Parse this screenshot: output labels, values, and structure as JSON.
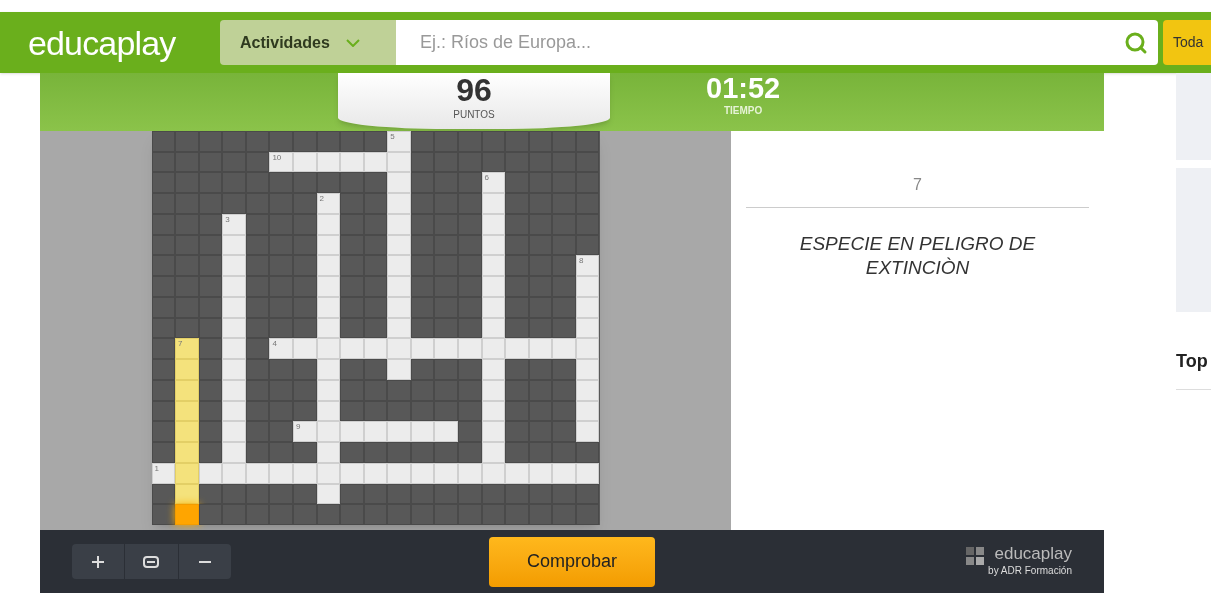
{
  "header": {
    "logo": "educaplay",
    "category": "Actividades",
    "search": {
      "placeholder": "Ej.: Ríos de Europa..."
    },
    "button": "Toda"
  },
  "score": {
    "points": "96",
    "points_label": "PUNTOS",
    "time": "01:52",
    "time_label": "TIEMPO"
  },
  "crossword": {
    "rows": [
      [
        {
          "kind": "block"
        },
        {
          "kind": "block"
        },
        {
          "kind": "block"
        },
        {
          "kind": "block"
        },
        {
          "kind": "block"
        },
        {
          "kind": "block"
        },
        {
          "kind": "block"
        },
        {
          "kind": "block"
        },
        {
          "kind": "block"
        },
        {
          "kind": "block"
        },
        {
          "kind": "blank",
          "number": "5"
        },
        {
          "kind": "block"
        },
        {
          "kind": "block"
        },
        {
          "kind": "block"
        },
        {
          "kind": "block"
        },
        {
          "kind": "block"
        },
        {
          "kind": "block"
        },
        {
          "kind": "block"
        },
        {
          "kind": "block"
        }
      ],
      [
        {
          "kind": "block"
        },
        {
          "kind": "block"
        },
        {
          "kind": "block"
        },
        {
          "kind": "block"
        },
        {
          "kind": "block"
        },
        {
          "kind": "blank",
          "number": "10"
        },
        {
          "kind": "blank"
        },
        {
          "kind": "blank"
        },
        {
          "kind": "blank"
        },
        {
          "kind": "blank"
        },
        {
          "kind": "blank"
        },
        {
          "kind": "block"
        },
        {
          "kind": "block"
        },
        {
          "kind": "block"
        },
        {
          "kind": "block"
        },
        {
          "kind": "block"
        },
        {
          "kind": "block"
        },
        {
          "kind": "block"
        },
        {
          "kind": "block"
        }
      ],
      [
        {
          "kind": "block"
        },
        {
          "kind": "block"
        },
        {
          "kind": "block"
        },
        {
          "kind": "block"
        },
        {
          "kind": "block"
        },
        {
          "kind": "block"
        },
        {
          "kind": "block"
        },
        {
          "kind": "block"
        },
        {
          "kind": "block"
        },
        {
          "kind": "block"
        },
        {
          "kind": "blank"
        },
        {
          "kind": "block"
        },
        {
          "kind": "block"
        },
        {
          "kind": "block"
        },
        {
          "kind": "blank",
          "number": "6"
        },
        {
          "kind": "block"
        },
        {
          "kind": "block"
        },
        {
          "kind": "block"
        },
        {
          "kind": "block"
        }
      ],
      [
        {
          "kind": "block"
        },
        {
          "kind": "block"
        },
        {
          "kind": "block"
        },
        {
          "kind": "block"
        },
        {
          "kind": "block"
        },
        {
          "kind": "block"
        },
        {
          "kind": "block"
        },
        {
          "kind": "blank",
          "number": "2"
        },
        {
          "kind": "block"
        },
        {
          "kind": "block"
        },
        {
          "kind": "blank"
        },
        {
          "kind": "block"
        },
        {
          "kind": "block"
        },
        {
          "kind": "block"
        },
        {
          "kind": "blank"
        },
        {
          "kind": "block"
        },
        {
          "kind": "block"
        },
        {
          "kind": "block"
        },
        {
          "kind": "block"
        }
      ],
      [
        {
          "kind": "block"
        },
        {
          "kind": "block"
        },
        {
          "kind": "block"
        },
        {
          "kind": "blank",
          "number": "3"
        },
        {
          "kind": "block"
        },
        {
          "kind": "block"
        },
        {
          "kind": "block"
        },
        {
          "kind": "blank"
        },
        {
          "kind": "block"
        },
        {
          "kind": "block"
        },
        {
          "kind": "blank"
        },
        {
          "kind": "block"
        },
        {
          "kind": "block"
        },
        {
          "kind": "block"
        },
        {
          "kind": "blank"
        },
        {
          "kind": "block"
        },
        {
          "kind": "block"
        },
        {
          "kind": "block"
        },
        {
          "kind": "block"
        }
      ],
      [
        {
          "kind": "block"
        },
        {
          "kind": "block"
        },
        {
          "kind": "block"
        },
        {
          "kind": "blank"
        },
        {
          "kind": "block"
        },
        {
          "kind": "block"
        },
        {
          "kind": "block"
        },
        {
          "kind": "blank"
        },
        {
          "kind": "block"
        },
        {
          "kind": "block"
        },
        {
          "kind": "blank"
        },
        {
          "kind": "block"
        },
        {
          "kind": "block"
        },
        {
          "kind": "block"
        },
        {
          "kind": "blank"
        },
        {
          "kind": "block"
        },
        {
          "kind": "block"
        },
        {
          "kind": "block"
        },
        {
          "kind": "block"
        }
      ],
      [
        {
          "kind": "block"
        },
        {
          "kind": "block"
        },
        {
          "kind": "block"
        },
        {
          "kind": "blank"
        },
        {
          "kind": "block"
        },
        {
          "kind": "block"
        },
        {
          "kind": "block"
        },
        {
          "kind": "blank"
        },
        {
          "kind": "block"
        },
        {
          "kind": "block"
        },
        {
          "kind": "blank"
        },
        {
          "kind": "block"
        },
        {
          "kind": "block"
        },
        {
          "kind": "block"
        },
        {
          "kind": "blank"
        },
        {
          "kind": "block"
        },
        {
          "kind": "block"
        },
        {
          "kind": "block"
        },
        {
          "kind": "blank",
          "number": "8"
        }
      ],
      [
        {
          "kind": "block"
        },
        {
          "kind": "block"
        },
        {
          "kind": "block"
        },
        {
          "kind": "blank"
        },
        {
          "kind": "block"
        },
        {
          "kind": "block"
        },
        {
          "kind": "block"
        },
        {
          "kind": "blank"
        },
        {
          "kind": "block"
        },
        {
          "kind": "block"
        },
        {
          "kind": "blank"
        },
        {
          "kind": "block"
        },
        {
          "kind": "block"
        },
        {
          "kind": "block"
        },
        {
          "kind": "blank"
        },
        {
          "kind": "block"
        },
        {
          "kind": "block"
        },
        {
          "kind": "block"
        },
        {
          "kind": "blank"
        }
      ],
      [
        {
          "kind": "block"
        },
        {
          "kind": "block"
        },
        {
          "kind": "block"
        },
        {
          "kind": "blank"
        },
        {
          "kind": "block"
        },
        {
          "kind": "block"
        },
        {
          "kind": "block"
        },
        {
          "kind": "blank"
        },
        {
          "kind": "block"
        },
        {
          "kind": "block"
        },
        {
          "kind": "blank"
        },
        {
          "kind": "block"
        },
        {
          "kind": "block"
        },
        {
          "kind": "block"
        },
        {
          "kind": "blank"
        },
        {
          "kind": "block"
        },
        {
          "kind": "block"
        },
        {
          "kind": "block"
        },
        {
          "kind": "blank"
        }
      ],
      [
        {
          "kind": "block"
        },
        {
          "kind": "block"
        },
        {
          "kind": "block"
        },
        {
          "kind": "blank"
        },
        {
          "kind": "block"
        },
        {
          "kind": "block"
        },
        {
          "kind": "block"
        },
        {
          "kind": "blank"
        },
        {
          "kind": "block"
        },
        {
          "kind": "block"
        },
        {
          "kind": "blank"
        },
        {
          "kind": "block"
        },
        {
          "kind": "block"
        },
        {
          "kind": "block"
        },
        {
          "kind": "blank"
        },
        {
          "kind": "block"
        },
        {
          "kind": "block"
        },
        {
          "kind": "block"
        },
        {
          "kind": "blank"
        }
      ],
      [
        {
          "kind": "block"
        },
        {
          "kind": "highlight",
          "number": "7"
        },
        {
          "kind": "block"
        },
        {
          "kind": "blank"
        },
        {
          "kind": "block"
        },
        {
          "kind": "blank",
          "number": "4"
        },
        {
          "kind": "blank"
        },
        {
          "kind": "blank"
        },
        {
          "kind": "blank"
        },
        {
          "kind": "blank"
        },
        {
          "kind": "blank"
        },
        {
          "kind": "blank"
        },
        {
          "kind": "blank"
        },
        {
          "kind": "blank"
        },
        {
          "kind": "blank"
        },
        {
          "kind": "blank"
        },
        {
          "kind": "blank"
        },
        {
          "kind": "blank"
        },
        {
          "kind": "blank"
        }
      ],
      [
        {
          "kind": "block"
        },
        {
          "kind": "highlight"
        },
        {
          "kind": "block"
        },
        {
          "kind": "blank"
        },
        {
          "kind": "block"
        },
        {
          "kind": "block"
        },
        {
          "kind": "block"
        },
        {
          "kind": "blank"
        },
        {
          "kind": "block"
        },
        {
          "kind": "block"
        },
        {
          "kind": "blank"
        },
        {
          "kind": "block"
        },
        {
          "kind": "block"
        },
        {
          "kind": "block"
        },
        {
          "kind": "blank"
        },
        {
          "kind": "block"
        },
        {
          "kind": "block"
        },
        {
          "kind": "block"
        },
        {
          "kind": "blank"
        }
      ],
      [
        {
          "kind": "block"
        },
        {
          "kind": "highlight"
        },
        {
          "kind": "block"
        },
        {
          "kind": "blank"
        },
        {
          "kind": "block"
        },
        {
          "kind": "block"
        },
        {
          "kind": "block"
        },
        {
          "kind": "blank"
        },
        {
          "kind": "block"
        },
        {
          "kind": "block"
        },
        {
          "kind": "block"
        },
        {
          "kind": "block"
        },
        {
          "kind": "block"
        },
        {
          "kind": "block"
        },
        {
          "kind": "blank"
        },
        {
          "kind": "block"
        },
        {
          "kind": "block"
        },
        {
          "kind": "block"
        },
        {
          "kind": "blank"
        }
      ],
      [
        {
          "kind": "block"
        },
        {
          "kind": "highlight"
        },
        {
          "kind": "block"
        },
        {
          "kind": "blank"
        },
        {
          "kind": "block"
        },
        {
          "kind": "block"
        },
        {
          "kind": "block"
        },
        {
          "kind": "blank"
        },
        {
          "kind": "block"
        },
        {
          "kind": "block"
        },
        {
          "kind": "block"
        },
        {
          "kind": "block"
        },
        {
          "kind": "block"
        },
        {
          "kind": "block"
        },
        {
          "kind": "blank"
        },
        {
          "kind": "block"
        },
        {
          "kind": "block"
        },
        {
          "kind": "block"
        },
        {
          "kind": "blank"
        }
      ],
      [
        {
          "kind": "block"
        },
        {
          "kind": "highlight"
        },
        {
          "kind": "block"
        },
        {
          "kind": "blank"
        },
        {
          "kind": "block"
        },
        {
          "kind": "block"
        },
        {
          "kind": "blank",
          "number": "9"
        },
        {
          "kind": "blank"
        },
        {
          "kind": "blank"
        },
        {
          "kind": "blank"
        },
        {
          "kind": "blank"
        },
        {
          "kind": "blank"
        },
        {
          "kind": "blank"
        },
        {
          "kind": "block"
        },
        {
          "kind": "blank"
        },
        {
          "kind": "block"
        },
        {
          "kind": "block"
        },
        {
          "kind": "block"
        },
        {
          "kind": "blank"
        }
      ],
      [
        {
          "kind": "block"
        },
        {
          "kind": "highlight"
        },
        {
          "kind": "block"
        },
        {
          "kind": "blank"
        },
        {
          "kind": "block"
        },
        {
          "kind": "block"
        },
        {
          "kind": "block"
        },
        {
          "kind": "blank"
        },
        {
          "kind": "block"
        },
        {
          "kind": "block"
        },
        {
          "kind": "block"
        },
        {
          "kind": "block"
        },
        {
          "kind": "block"
        },
        {
          "kind": "block"
        },
        {
          "kind": "blank"
        },
        {
          "kind": "block"
        },
        {
          "kind": "block"
        },
        {
          "kind": "block"
        },
        {
          "kind": "block"
        }
      ],
      [
        {
          "kind": "blank",
          "number": "1"
        },
        {
          "kind": "highlight"
        },
        {
          "kind": "blank"
        },
        {
          "kind": "blank"
        },
        {
          "kind": "blank"
        },
        {
          "kind": "blank"
        },
        {
          "kind": "blank"
        },
        {
          "kind": "blank"
        },
        {
          "kind": "blank"
        },
        {
          "kind": "blank"
        },
        {
          "kind": "blank"
        },
        {
          "kind": "blank"
        },
        {
          "kind": "blank"
        },
        {
          "kind": "blank"
        },
        {
          "kind": "blank"
        },
        {
          "kind": "blank"
        },
        {
          "kind": "blank"
        },
        {
          "kind": "blank"
        },
        {
          "kind": "blank"
        }
      ],
      [
        {
          "kind": "block"
        },
        {
          "kind": "highlight"
        },
        {
          "kind": "block"
        },
        {
          "kind": "block"
        },
        {
          "kind": "block"
        },
        {
          "kind": "block"
        },
        {
          "kind": "block"
        },
        {
          "kind": "blank"
        },
        {
          "kind": "block"
        },
        {
          "kind": "block"
        },
        {
          "kind": "block"
        },
        {
          "kind": "block"
        },
        {
          "kind": "block"
        },
        {
          "kind": "block"
        },
        {
          "kind": "block"
        },
        {
          "kind": "block"
        },
        {
          "kind": "block"
        },
        {
          "kind": "block"
        },
        {
          "kind": "block"
        }
      ],
      [
        {
          "kind": "block"
        },
        {
          "kind": "current"
        },
        {
          "kind": "block"
        },
        {
          "kind": "block"
        },
        {
          "kind": "block"
        },
        {
          "kind": "block"
        },
        {
          "kind": "block"
        },
        {
          "kind": "block"
        },
        {
          "kind": "block"
        },
        {
          "kind": "block"
        },
        {
          "kind": "block"
        },
        {
          "kind": "block"
        },
        {
          "kind": "block"
        },
        {
          "kind": "block"
        },
        {
          "kind": "block"
        },
        {
          "kind": "block"
        },
        {
          "kind": "block"
        },
        {
          "kind": "block"
        },
        {
          "kind": "block"
        }
      ]
    ]
  },
  "clue": {
    "number": "7",
    "text": "ESPECIE EN PELIGRO DE EXTINCIÒN"
  },
  "toolbar": {
    "check_button": "Comprobar",
    "brand": "educaplay",
    "brand_sub": "by ADR Formación"
  },
  "sidebar": {
    "heading": "Top"
  }
}
